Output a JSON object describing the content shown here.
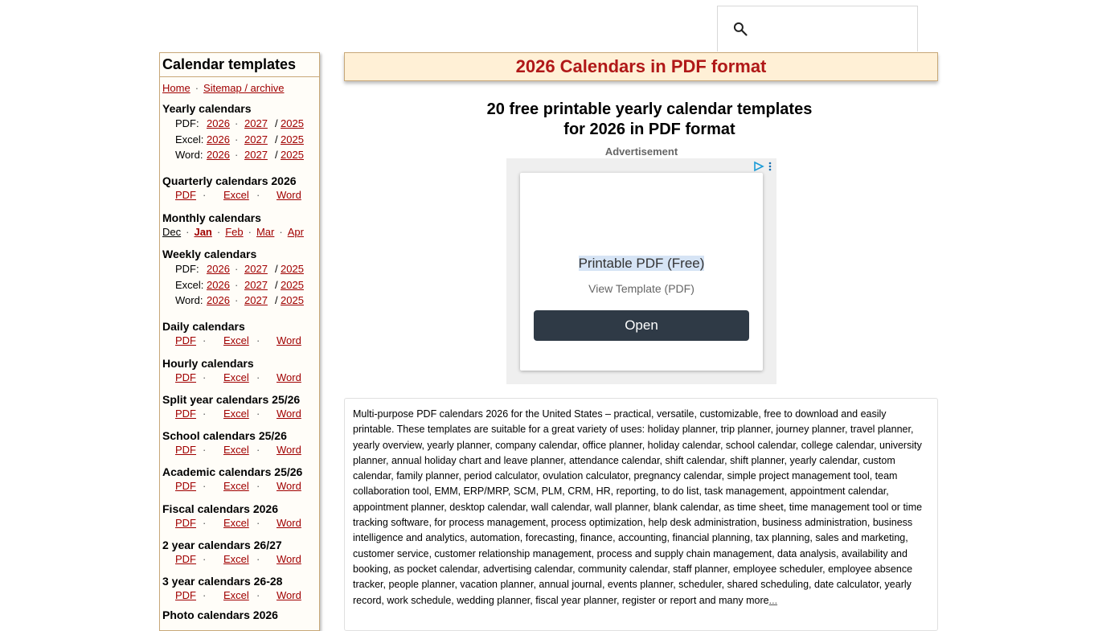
{
  "search": {
    "placeholder": "",
    "value": ""
  },
  "sidebar": {
    "title": "Calendar templates",
    "top_links": [
      "Home",
      "Sitemap / archive"
    ],
    "yearly": {
      "title": "Yearly calendars",
      "rows": [
        {
          "label": "PDF:",
          "y1": "2026",
          "y2": "2027",
          "y3": "2025"
        },
        {
          "label": "Excel:",
          "y1": "2026",
          "y2": "2027",
          "y3": "2025"
        },
        {
          "label": "Word:",
          "y1": "2026",
          "y2": "2027",
          "y3": "2025"
        }
      ]
    },
    "quarterly": {
      "title": "Quarterly calendars 2026"
    },
    "monthly": {
      "title": "Monthly calendars",
      "months": [
        "Dec",
        "Jan",
        "Feb",
        "Mar",
        "Apr"
      ]
    },
    "weekly": {
      "title": "Weekly calendars",
      "rows": [
        {
          "label": "PDF:",
          "y1": "2026",
          "y2": "2027",
          "y3": "2025"
        },
        {
          "label": "Excel:",
          "y1": "2026",
          "y2": "2027",
          "y3": "2025"
        },
        {
          "label": "Word:",
          "y1": "2026",
          "y2": "2027",
          "y3": "2025"
        }
      ]
    },
    "daily": {
      "title": "Daily calendars"
    },
    "hourly": {
      "title": "Hourly calendars"
    },
    "split": {
      "title": "Split year calendars 25/26"
    },
    "school": {
      "title": "School calendars 25/26"
    },
    "academic": {
      "title": "Academic calendars 25/26"
    },
    "fiscal": {
      "title": "Fiscal calendars 2026"
    },
    "two_year": {
      "title": "2 year calendars 26/27"
    },
    "three_year": {
      "title": "3 year calendars 26-28"
    },
    "photo": {
      "title": "Photo calendars 2026"
    },
    "formats": {
      "pdf": "PDF",
      "excel": "Excel",
      "word": "Word"
    },
    "separator": "·",
    "slash": "/"
  },
  "main": {
    "title": "2026 Calendars in PDF format",
    "subtitle": "20 free printable yearly calendar templates for 2026 in PDF format",
    "ad_label": "Advertisement",
    "ad": {
      "headline": "Printable PDF (Free)",
      "subline": "View Template (PDF)",
      "button": "Open"
    },
    "description": "Multi-purpose PDF calendars 2026 for the        United States – practical, versatile, customizable, free to download and easily printable. These templates are suitable for a great variety of uses: holiday planner, trip planner, journey planner, travel planner, yearly overview, yearly planner, company calendar, office planner, holiday calendar, school calendar, college calendar, university planner, annual holiday chart and leave planner, attendance calendar, shift calendar, shift planner, yearly calendar, custom calendar, family planner, period calculator, ovulation calculator, pregnancy calendar, simple project management tool, team collaboration tool, EMM, ERP/MRP, SCM, PLM, CRM, HR, reporting, to do list, task management, appointment calendar, appointment planner, desktop calendar, wall calendar, wall planner, blank calendar, as time sheet, time management tool or time tracking software, for process management, process optimization, help desk administration, business administration, business intelligence and analytics, automation, forecasting, finance, accounting, financial planning, tax planning, sales and marketing, customer service, customer relationship management, process and supply chain management, data analysis, availability and booking, as pocket calendar, advertising calendar, community calendar, staff planner, employee scheduler, employee absence tracker, people planner, vacation planner, annual journal, events planner, scheduler, shared scheduling, date calculator, yearly record, work schedule, wedding planner, fiscal year planner, register or report and many more",
    "description_more": "..."
  }
}
